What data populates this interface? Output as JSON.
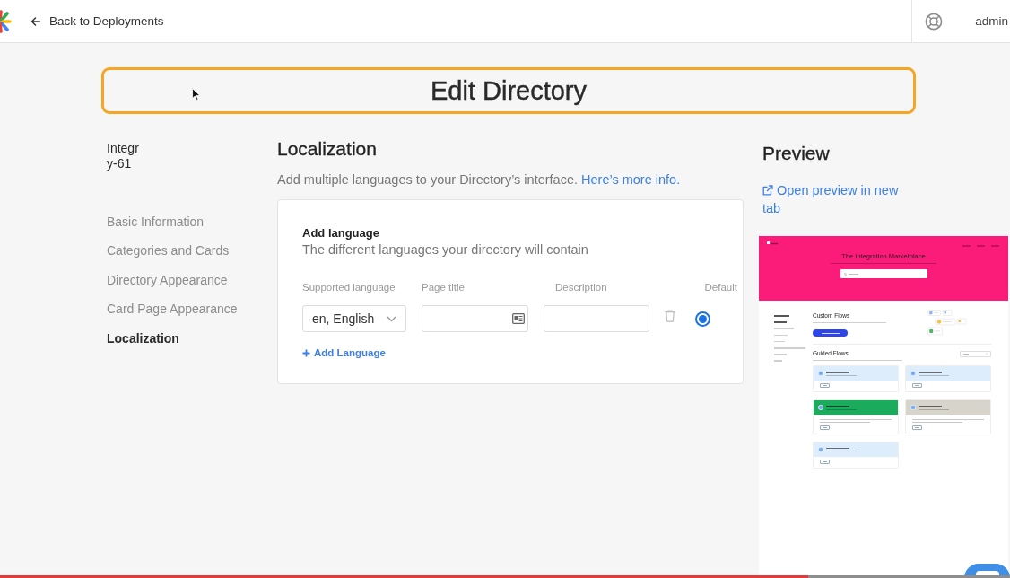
{
  "header": {
    "back_label": "Back to Deployments",
    "user": "admin"
  },
  "page_title": "Edit Directory",
  "sidebar": {
    "directory_name": "Integry-61",
    "items": [
      {
        "label": "Basic Information",
        "selected": false
      },
      {
        "label": "Categories and Cards",
        "selected": false
      },
      {
        "label": "Directory Appearance",
        "selected": false
      },
      {
        "label": "Card Page Appearance",
        "selected": false
      },
      {
        "label": "Localization",
        "selected": true
      }
    ]
  },
  "localization": {
    "title": "Localization",
    "description": "Add multiple languages to your Directory’s interface.",
    "info_link": "Here’s more info.",
    "card": {
      "title": "Add language",
      "subtitle": "The different languages your directory will contain",
      "columns": [
        "Supported language",
        "Page title",
        "Description",
        "Default"
      ],
      "rows": [
        {
          "language": "en, English",
          "default": true
        }
      ],
      "add_button": "Add Language"
    }
  },
  "preview": {
    "title": "Preview",
    "open_link": "Open preview in new tab",
    "thumbnail": {
      "heading": "The Integration Marketplace",
      "categories": [
        {
          "selected": true
        },
        {
          "selected": false
        },
        {
          "selected": false
        },
        {
          "selected": false
        },
        {
          "selected": false
        },
        {
          "selected": false
        },
        {
          "selected": false
        }
      ],
      "custom_flows": {
        "title": "Custom Flows"
      },
      "guided_flows": {
        "title": "Guided Flows",
        "cards": [
          {
            "kind": "basic",
            "color": "#ddedfc"
          },
          {
            "kind": "basic",
            "color": "#ddedfc"
          },
          {
            "kind": "detailed",
            "color": "#1bab5c"
          },
          {
            "kind": "detailed",
            "color": "#d7d4cb"
          },
          {
            "kind": "basic",
            "color": "#ddedfc"
          }
        ]
      }
    }
  },
  "playback_bar": {
    "level": 0.8
  }
}
